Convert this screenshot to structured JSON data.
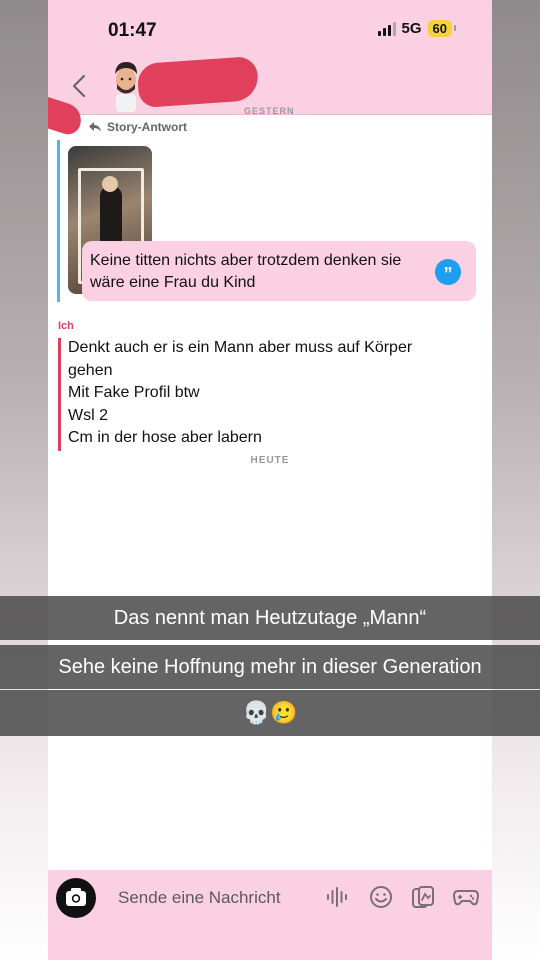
{
  "status_bar": {
    "time": "01:47",
    "network": "5G",
    "battery": "60"
  },
  "chat": {
    "date_previous": "GESTERN",
    "story_reply_label": "Story-Antwort",
    "reply_text": "Keine titten nichts aber trotzdem denken sie wäre eine Frau du Kind",
    "sender_label": "Ich",
    "messages": [
      "Denkt auch er is ein Mann aber muss auf Körper",
      "gehen",
      "Mit Fake Profil btw",
      "Wsl 2",
      "Cm in der hose aber labern"
    ],
    "date_today": "HEUTE"
  },
  "captions": [
    "Das nennt man Heutzutage „Mann“",
    "Sehe keine Hoffnung mehr in dieser Generation",
    "💀🥲"
  ],
  "composer": {
    "placeholder": "Sende eine Nachricht"
  },
  "colors": {
    "accent_pink": "#fbd0e3",
    "reply_blue": "#4fb5ef",
    "me_red": "#e0405b",
    "caption_bg": "#4b4b4b"
  },
  "icons": [
    "back-chevron-icon",
    "reply-arrow-icon",
    "quote-icon",
    "camera-icon",
    "voice-icon",
    "emoji-icon",
    "sticker-icon",
    "game-icon"
  ]
}
